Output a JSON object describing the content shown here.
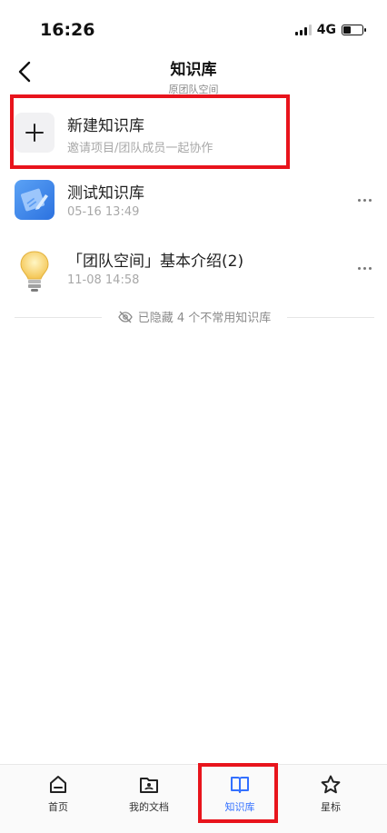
{
  "status_bar": {
    "time": "16:26",
    "network": "4G"
  },
  "nav": {
    "title": "知识库",
    "subtitle": "原团队空间"
  },
  "new_kb": {
    "title": "新建知识库",
    "subtitle": "邀请项目/团队成员一起协作"
  },
  "items": [
    {
      "title": "测试知识库",
      "date": "05-16 13:49",
      "icon": "document-pen-icon"
    },
    {
      "title": "「团队空间」基本介绍(2)",
      "date": "11-08 14:58",
      "icon": "lightbulb-icon"
    }
  ],
  "hidden_note": "已隐藏 4 个不常用知识库",
  "tabs": [
    {
      "label": "首页",
      "icon": "home-icon"
    },
    {
      "label": "我的文档",
      "icon": "my-docs-icon"
    },
    {
      "label": "知识库",
      "icon": "book-icon",
      "active": true
    },
    {
      "label": "星标",
      "icon": "star-icon"
    }
  ],
  "colors": {
    "accent": "#3370ff",
    "highlight": "#e8141c",
    "muted": "#a8a8a8"
  }
}
